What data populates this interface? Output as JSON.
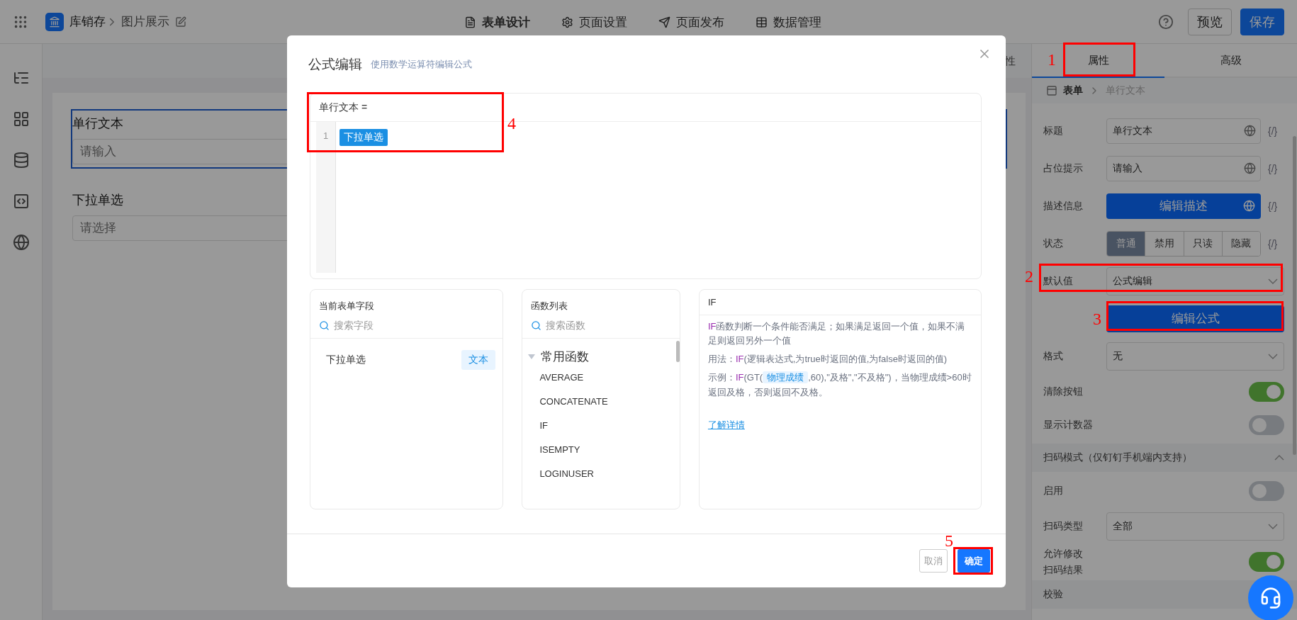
{
  "topbar": {
    "app_name": "库销存",
    "page_name": "图片展示",
    "tabs": [
      {
        "label": "表单设计",
        "selected": true
      },
      {
        "label": "页面设置",
        "selected": false
      },
      {
        "label": "页面发布",
        "selected": false
      },
      {
        "label": "数据管理",
        "selected": false
      }
    ],
    "preview": "预览",
    "save": "保存"
  },
  "canvas": {
    "header_tab": "性",
    "fields": [
      {
        "label": "单行文本",
        "placeholder": "请输入",
        "selected": true
      },
      {
        "label": "下拉单选",
        "placeholder": "请选择",
        "selected": false
      }
    ]
  },
  "properties": {
    "tabs": [
      {
        "label": "属性",
        "selected": true
      },
      {
        "label": "高级",
        "selected": false
      }
    ],
    "breadcrumb": [
      "表单",
      "单行文本"
    ],
    "rows": [
      {
        "kind": "input",
        "label": "标题",
        "value": "单行文本",
        "binding": "{/}"
      },
      {
        "kind": "input",
        "label": "占位提示",
        "value": "请输入",
        "binding": "{/}"
      },
      {
        "kind": "button",
        "label": "描述信息",
        "value": "编辑描述",
        "binding": "{/}"
      },
      {
        "kind": "segmented",
        "label": "状态",
        "binding": "{/}",
        "options": [
          {
            "label": "普通",
            "selected": true
          },
          {
            "label": "禁用",
            "selected": false
          },
          {
            "label": "只读",
            "selected": false
          },
          {
            "label": "隐藏",
            "selected": false
          }
        ]
      },
      {
        "kind": "select",
        "label": "默认值",
        "value": "公式编辑"
      },
      {
        "kind": "action",
        "value": "编辑公式"
      },
      {
        "kind": "select",
        "label": "格式",
        "value": "无"
      },
      {
        "kind": "toggle",
        "label": "清除按钮",
        "on": true
      },
      {
        "kind": "toggle",
        "label": "显示计数器",
        "on": false
      },
      {
        "kind": "section",
        "label": "扫码模式（仅钉钉手机端内支持）",
        "expanded": true
      },
      {
        "kind": "toggle",
        "label": "启用",
        "on": false
      },
      {
        "kind": "select",
        "label": "扫码类型",
        "value": "全部"
      },
      {
        "kind": "toggle",
        "label": "允许修改扫码结果",
        "on": true
      },
      {
        "kind": "section",
        "label": "校验"
      }
    ]
  },
  "modal": {
    "title": "公式编辑",
    "subtitle": "使用数学运算符编辑公式",
    "editor": {
      "target": "单行文本 =",
      "lines": [
        {
          "number": "1",
          "tokens": [
            "下拉单选"
          ]
        }
      ]
    },
    "fields_panel": {
      "title": "当前表单字段",
      "search_placeholder": "搜索字段",
      "items": [
        {
          "name": "下拉单选",
          "type": "文本"
        }
      ]
    },
    "functions_panel": {
      "title": "函数列表",
      "search_placeholder": "搜索函数",
      "groups": [
        {
          "name": "常用函数",
          "expanded": true,
          "items": [
            "AVERAGE",
            "CONCATENATE",
            "IF",
            "ISEMPTY",
            "LOGINUSER"
          ]
        }
      ]
    },
    "help_panel": {
      "title": "IF",
      "paragraphs": [
        {
          "fn": "IF",
          "text": "函数判断一个条件能否满足；如果满足返回一个值，如果不满足则返回另外一个值"
        },
        {
          "label": "用法：",
          "fn": "IF",
          "text": "(逻辑表达式,为true时返回的值,为false时返回的值)"
        },
        {
          "label": "示例：",
          "fn": "IF",
          "text": "(GT(",
          "chip": "物理成绩",
          "after": ",60),\"及格\",\"不及格\")，当物理成绩>60时返回及格，否则返回不及格。"
        }
      ],
      "link": "了解详情"
    },
    "cancel": "取消",
    "ok": "确定"
  },
  "annotations": [
    "1",
    "2",
    "3",
    "4",
    "5"
  ]
}
